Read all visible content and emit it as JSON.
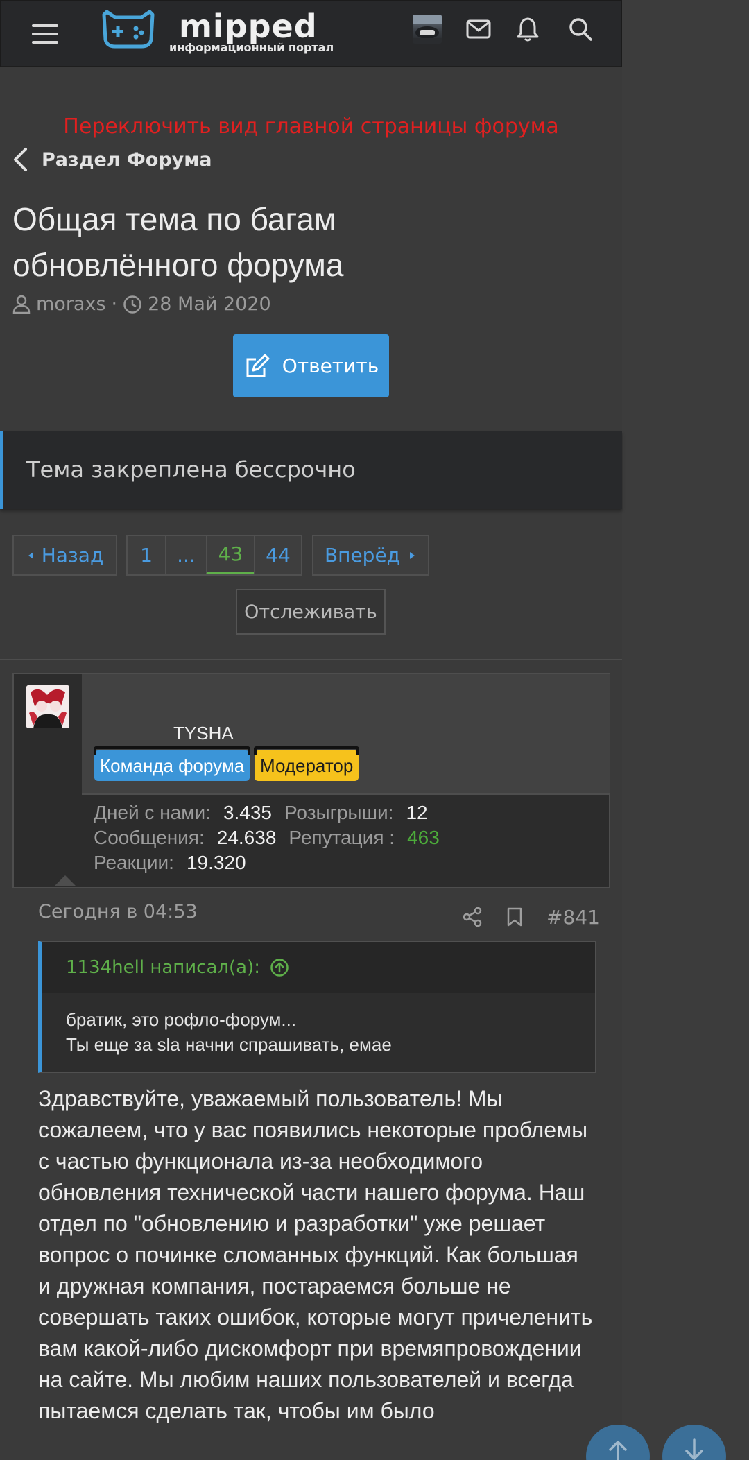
{
  "header": {
    "logo_text": "mipped",
    "logo_subtitle": "информационный портал"
  },
  "switch_link": "Переключить вид главной страницы форума",
  "breadcrumb": {
    "label": "Раздел Форума"
  },
  "thread": {
    "title": "Общая тема по багам обновлённого форума",
    "author": "moraxs",
    "separator": "·",
    "date": "28 Май 2020",
    "reply_label": "Ответить",
    "notice": "Тема закреплена бессрочно"
  },
  "pagination": {
    "prev": "Назад",
    "pages": [
      "1",
      "...",
      "43",
      "44"
    ],
    "current": "43",
    "next": "Вперёд",
    "watch": "Отслеживать"
  },
  "post": {
    "username": "TYSHA",
    "badges": [
      "Команда форума",
      "Модератор"
    ],
    "stats": {
      "days_label": "Дней с нами:",
      "days": "3.435",
      "giveaways_label": "Розыгрыши:",
      "giveaways": "12",
      "messages_label": "Сообщения:",
      "messages": "24.638",
      "reputation_label": "Репутация :",
      "reputation": "463",
      "reactions_label": "Реакции:",
      "reactions": "19.320"
    },
    "time": "Сегодня в 04:53",
    "number": "#841",
    "quote": {
      "author": "1134hell написал(а):",
      "line1": "братик, это рофло-форум...",
      "line2": "Ты еще за sla начни спрашивать, емае"
    },
    "body": "Здравствуйте, уважаемый пользователь! Мы сожалеем, что у вас появились некоторые проблемы с частью функционала из-за необходимого обновления технической части нашего форума. Наш отдел по \"обновлению и разработки\" уже решает вопрос о починке сломанных функций. Как большая и дружная компания, постараемся больше не совершать таких ошибок, которые могут причеленить вам какой-либо дискомфорт при времяпровождении на сайте. Мы любим наших пользователей и всегда пытаемся сделать так, чтобы им было"
  },
  "colors": {
    "accent": "#3b95d8",
    "link_red": "#e02020",
    "green": "#5fb04a",
    "moderator_yellow": "#f6c21c"
  }
}
